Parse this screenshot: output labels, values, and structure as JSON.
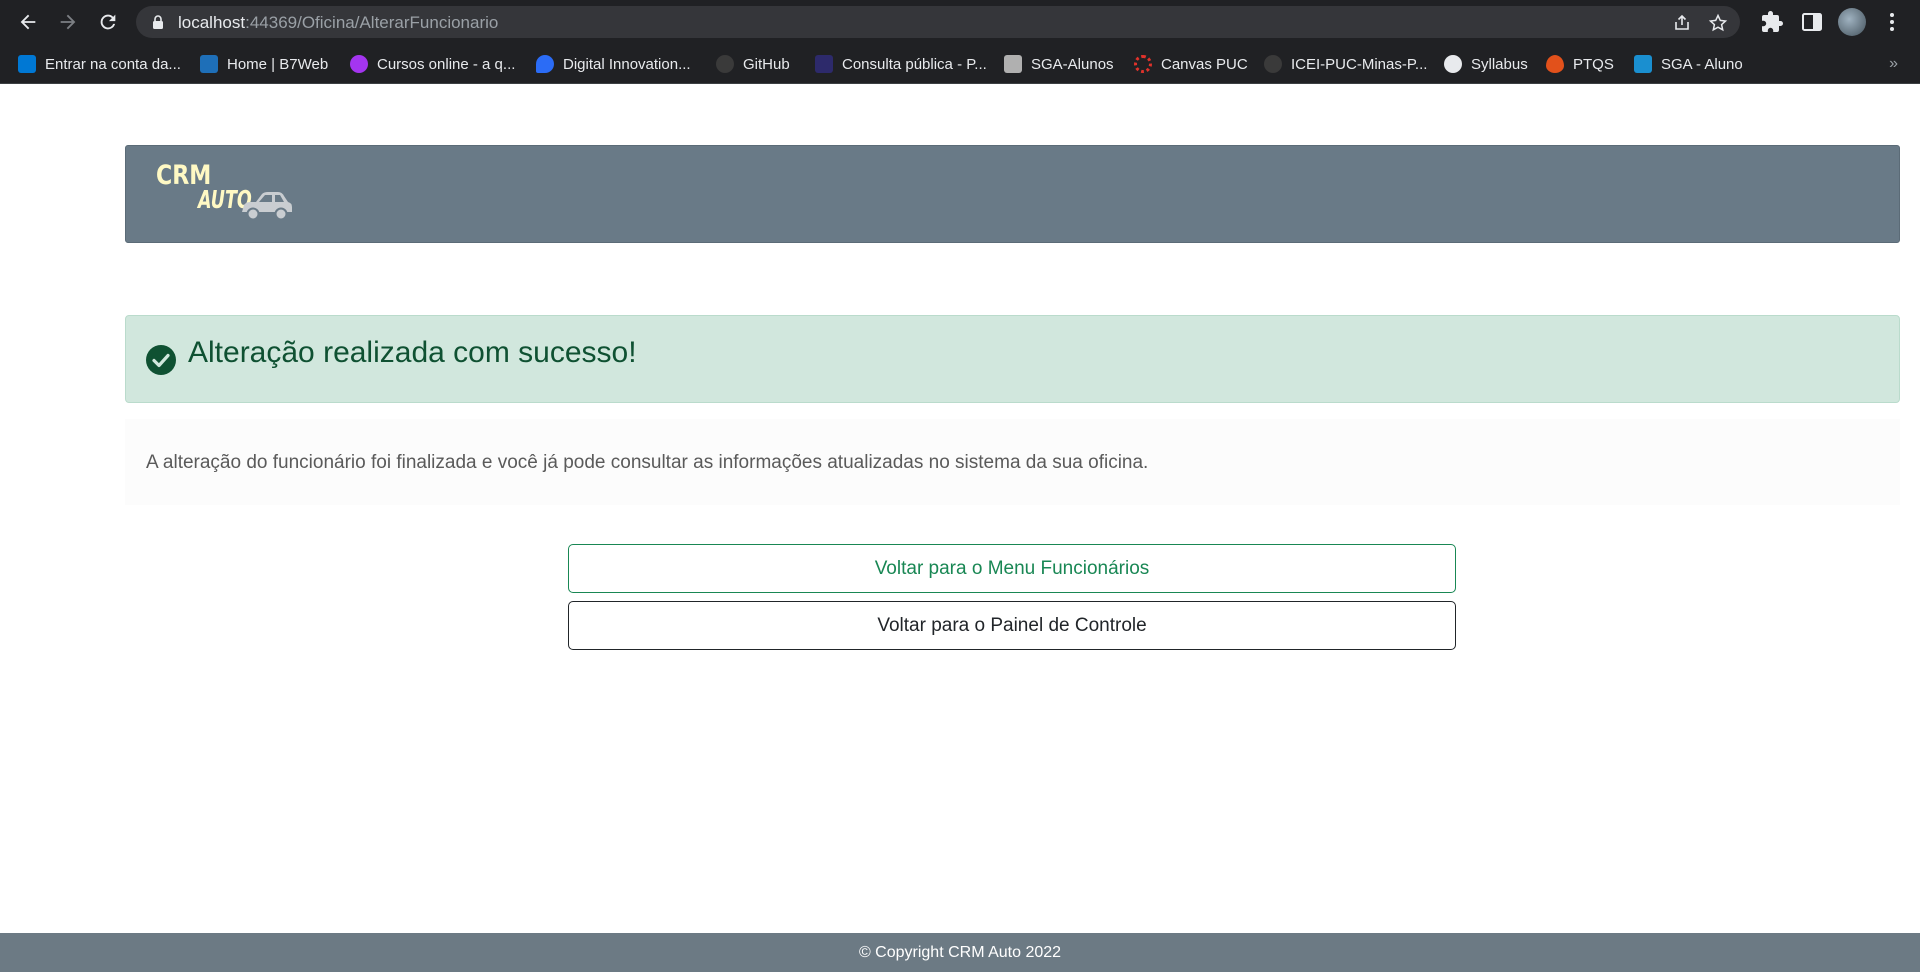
{
  "browser": {
    "url_host": "localhost",
    "url_path": ":44369/Oficina/AlterarFuncionario",
    "bookmarks": [
      {
        "label": "Entrar na conta da...",
        "color": "#0078d4"
      },
      {
        "label": "Home | B7Web",
        "color": "#1e6fb8"
      },
      {
        "label": "Cursos online - a q...",
        "color": "#a435f0"
      },
      {
        "label": "Digital Innovation...",
        "color": "#2b6cf6"
      },
      {
        "label": "GitHub",
        "color": "#3a3a3a"
      },
      {
        "label": "Consulta pública - P...",
        "color": "#2d2a6b"
      },
      {
        "label": "SGA-Alunos",
        "color": "#b0b0b0"
      },
      {
        "label": "Canvas PUC",
        "color": "#e0322b"
      },
      {
        "label": "ICEI-PUC-Minas-P...",
        "color": "#3a3a3a"
      },
      {
        "label": "Syllabus",
        "color": "#e8eaed"
      },
      {
        "label": "PTQS",
        "color": "#e2511b"
      },
      {
        "label": "SGA - Aluno",
        "color": "#1a8fd0"
      }
    ],
    "more": "»"
  },
  "header": {
    "logo_line1": "CRM",
    "logo_line2": "AUTO"
  },
  "alert": {
    "message": "Alteração realizada com sucesso!"
  },
  "info": {
    "text": "A alteração do funcionário foi finalizada e você já pode consultar as informações atualizadas no sistema da sua oficina."
  },
  "actions": {
    "menu_funcionarios": "Voltar para o Menu Funcionários",
    "painel_controle": "Voltar para o Painel de Controle"
  },
  "footer": {
    "copyright": "© Copyright CRM Auto 2022"
  },
  "colors": {
    "header_bg": "#697a87",
    "success_bg": "#d1e7dd",
    "success_text": "#0f5132",
    "btn_success": "#198754",
    "footer_bg": "#6c7a84"
  }
}
